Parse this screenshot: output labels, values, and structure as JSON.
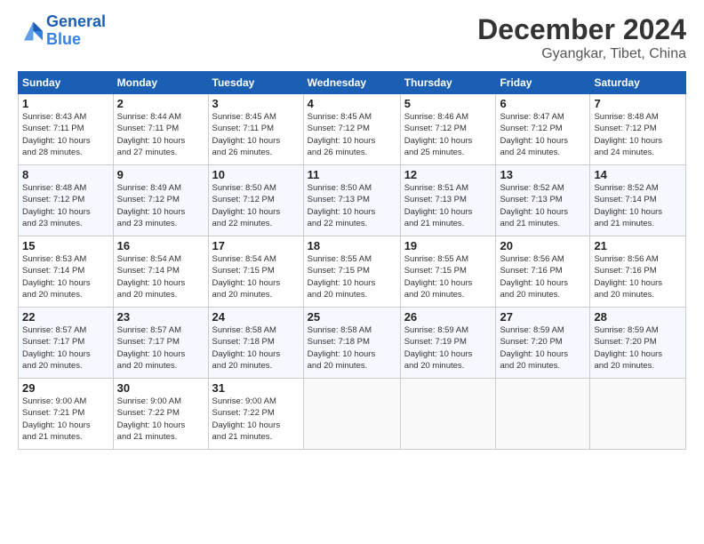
{
  "header": {
    "logo_line1": "General",
    "logo_line2": "Blue",
    "month": "December 2024",
    "location": "Gyangkar, Tibet, China"
  },
  "weekdays": [
    "Sunday",
    "Monday",
    "Tuesday",
    "Wednesday",
    "Thursday",
    "Friday",
    "Saturday"
  ],
  "weeks": [
    [
      {
        "day": "1",
        "info": "Sunrise: 8:43 AM\nSunset: 7:11 PM\nDaylight: 10 hours\nand 28 minutes."
      },
      {
        "day": "2",
        "info": "Sunrise: 8:44 AM\nSunset: 7:11 PM\nDaylight: 10 hours\nand 27 minutes."
      },
      {
        "day": "3",
        "info": "Sunrise: 8:45 AM\nSunset: 7:11 PM\nDaylight: 10 hours\nand 26 minutes."
      },
      {
        "day": "4",
        "info": "Sunrise: 8:45 AM\nSunset: 7:12 PM\nDaylight: 10 hours\nand 26 minutes."
      },
      {
        "day": "5",
        "info": "Sunrise: 8:46 AM\nSunset: 7:12 PM\nDaylight: 10 hours\nand 25 minutes."
      },
      {
        "day": "6",
        "info": "Sunrise: 8:47 AM\nSunset: 7:12 PM\nDaylight: 10 hours\nand 24 minutes."
      },
      {
        "day": "7",
        "info": "Sunrise: 8:48 AM\nSunset: 7:12 PM\nDaylight: 10 hours\nand 24 minutes."
      }
    ],
    [
      {
        "day": "8",
        "info": "Sunrise: 8:48 AM\nSunset: 7:12 PM\nDaylight: 10 hours\nand 23 minutes."
      },
      {
        "day": "9",
        "info": "Sunrise: 8:49 AM\nSunset: 7:12 PM\nDaylight: 10 hours\nand 23 minutes."
      },
      {
        "day": "10",
        "info": "Sunrise: 8:50 AM\nSunset: 7:12 PM\nDaylight: 10 hours\nand 22 minutes."
      },
      {
        "day": "11",
        "info": "Sunrise: 8:50 AM\nSunset: 7:13 PM\nDaylight: 10 hours\nand 22 minutes."
      },
      {
        "day": "12",
        "info": "Sunrise: 8:51 AM\nSunset: 7:13 PM\nDaylight: 10 hours\nand 21 minutes."
      },
      {
        "day": "13",
        "info": "Sunrise: 8:52 AM\nSunset: 7:13 PM\nDaylight: 10 hours\nand 21 minutes."
      },
      {
        "day": "14",
        "info": "Sunrise: 8:52 AM\nSunset: 7:14 PM\nDaylight: 10 hours\nand 21 minutes."
      }
    ],
    [
      {
        "day": "15",
        "info": "Sunrise: 8:53 AM\nSunset: 7:14 PM\nDaylight: 10 hours\nand 20 minutes."
      },
      {
        "day": "16",
        "info": "Sunrise: 8:54 AM\nSunset: 7:14 PM\nDaylight: 10 hours\nand 20 minutes."
      },
      {
        "day": "17",
        "info": "Sunrise: 8:54 AM\nSunset: 7:15 PM\nDaylight: 10 hours\nand 20 minutes."
      },
      {
        "day": "18",
        "info": "Sunrise: 8:55 AM\nSunset: 7:15 PM\nDaylight: 10 hours\nand 20 minutes."
      },
      {
        "day": "19",
        "info": "Sunrise: 8:55 AM\nSunset: 7:15 PM\nDaylight: 10 hours\nand 20 minutes."
      },
      {
        "day": "20",
        "info": "Sunrise: 8:56 AM\nSunset: 7:16 PM\nDaylight: 10 hours\nand 20 minutes."
      },
      {
        "day": "21",
        "info": "Sunrise: 8:56 AM\nSunset: 7:16 PM\nDaylight: 10 hours\nand 20 minutes."
      }
    ],
    [
      {
        "day": "22",
        "info": "Sunrise: 8:57 AM\nSunset: 7:17 PM\nDaylight: 10 hours\nand 20 minutes."
      },
      {
        "day": "23",
        "info": "Sunrise: 8:57 AM\nSunset: 7:17 PM\nDaylight: 10 hours\nand 20 minutes."
      },
      {
        "day": "24",
        "info": "Sunrise: 8:58 AM\nSunset: 7:18 PM\nDaylight: 10 hours\nand 20 minutes."
      },
      {
        "day": "25",
        "info": "Sunrise: 8:58 AM\nSunset: 7:18 PM\nDaylight: 10 hours\nand 20 minutes."
      },
      {
        "day": "26",
        "info": "Sunrise: 8:59 AM\nSunset: 7:19 PM\nDaylight: 10 hours\nand 20 minutes."
      },
      {
        "day": "27",
        "info": "Sunrise: 8:59 AM\nSunset: 7:20 PM\nDaylight: 10 hours\nand 20 minutes."
      },
      {
        "day": "28",
        "info": "Sunrise: 8:59 AM\nSunset: 7:20 PM\nDaylight: 10 hours\nand 20 minutes."
      }
    ],
    [
      {
        "day": "29",
        "info": "Sunrise: 9:00 AM\nSunset: 7:21 PM\nDaylight: 10 hours\nand 21 minutes."
      },
      {
        "day": "30",
        "info": "Sunrise: 9:00 AM\nSunset: 7:22 PM\nDaylight: 10 hours\nand 21 minutes."
      },
      {
        "day": "31",
        "info": "Sunrise: 9:00 AM\nSunset: 7:22 PM\nDaylight: 10 hours\nand 21 minutes."
      },
      {
        "day": "",
        "info": ""
      },
      {
        "day": "",
        "info": ""
      },
      {
        "day": "",
        "info": ""
      },
      {
        "day": "",
        "info": ""
      }
    ]
  ]
}
